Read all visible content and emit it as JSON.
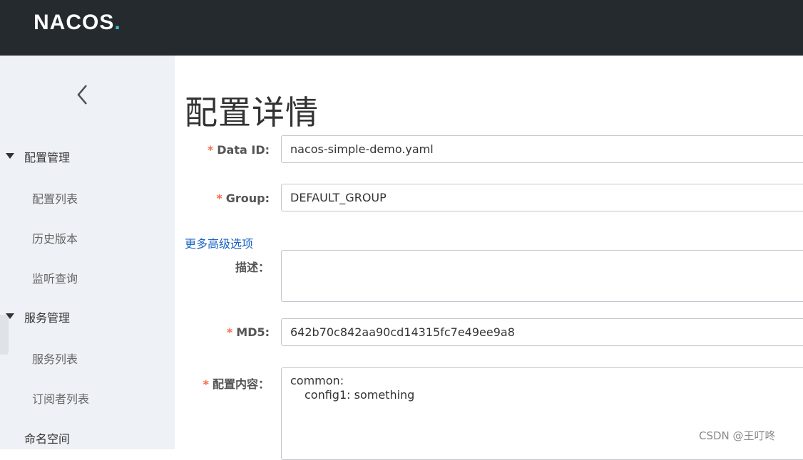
{
  "brand": {
    "logo_text": "NACOS",
    "logo_dot": ".",
    "accent_color": "#3ec2d3"
  },
  "sidebar": {
    "collapse_icon": "chevron-left-icon",
    "groups": [
      {
        "label": "配置管理",
        "items": [
          "配置列表",
          "历史版本",
          "监听查询"
        ]
      },
      {
        "label": "服务管理",
        "items": [
          "服务列表",
          "订阅者列表"
        ]
      }
    ],
    "namespace_label": "命名空间"
  },
  "main": {
    "title": "配置详情",
    "form": {
      "data_id": {
        "label": "Data ID:",
        "value": "nacos-simple-demo.yaml",
        "required": true
      },
      "group": {
        "label": "Group:",
        "value": "DEFAULT_GROUP",
        "required": true
      },
      "more_link": "更多高级选项",
      "description": {
        "label": "描述：",
        "value": ""
      },
      "md5": {
        "label": "MD5:",
        "value": "642b70c842aa90cd14315fc7e49ee9a8",
        "required": true
      },
      "content": {
        "label": "配置内容：",
        "required": true,
        "lines": [
          "common:",
          "config1: something"
        ]
      }
    }
  },
  "watermark": "CSDN @王叮咚",
  "required_mark": "*"
}
